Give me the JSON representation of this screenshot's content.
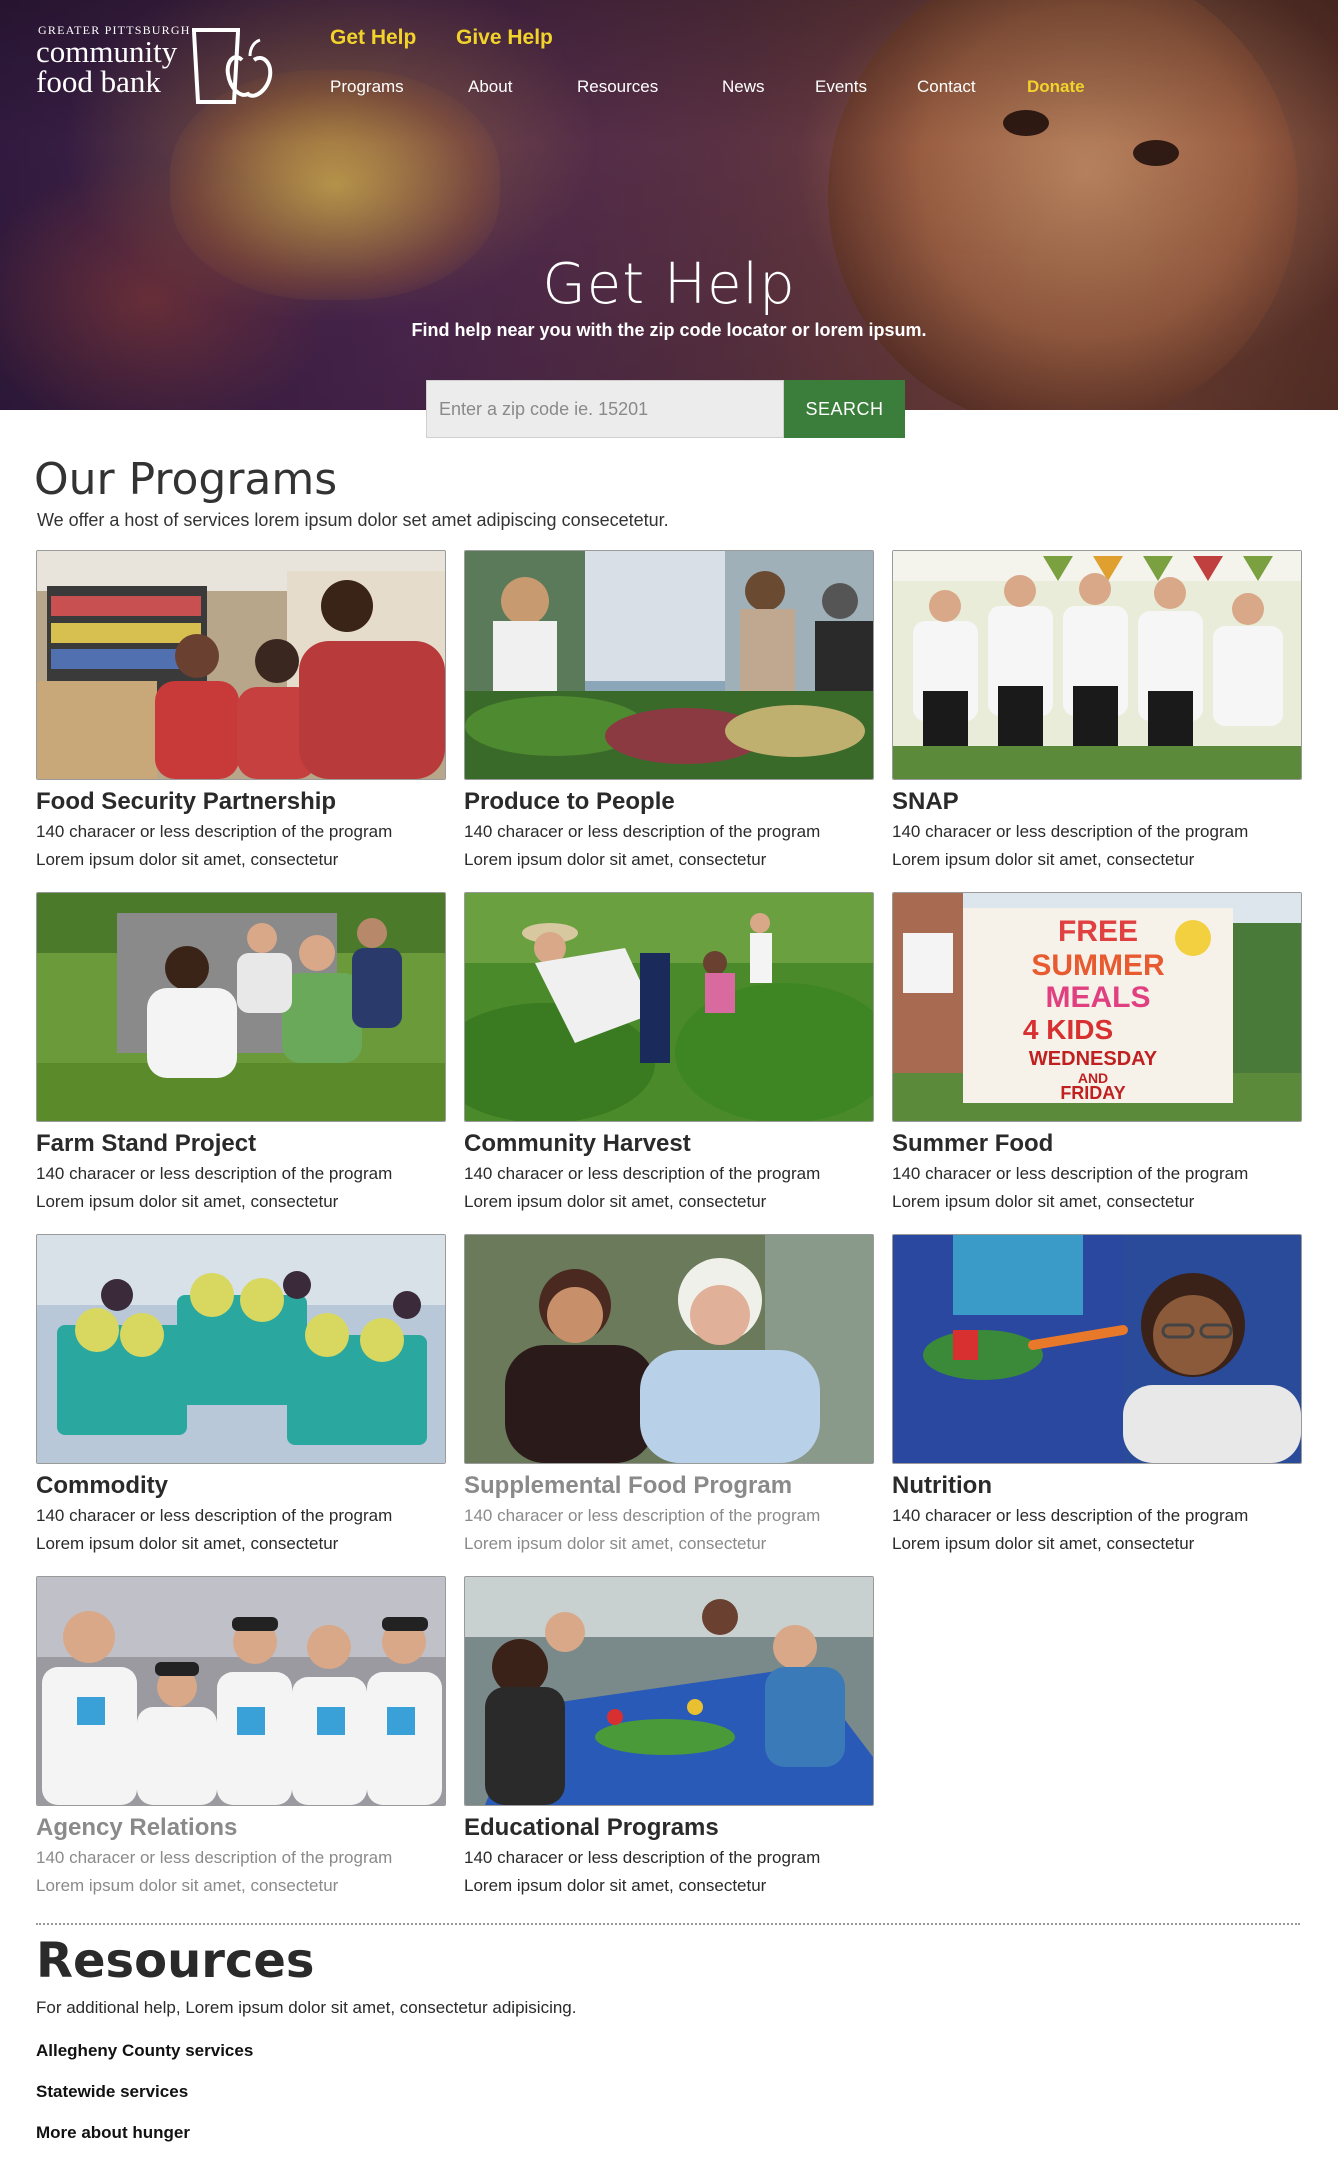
{
  "logo": {
    "small_text": "GREATER PITTSBURGH",
    "line1": "community",
    "line2": "food bank",
    "icon": "cup-apple-icon"
  },
  "nav": {
    "top": [
      "Get Help",
      "Give Help"
    ],
    "main": [
      "Programs",
      "About",
      "Resources",
      "News",
      "Events",
      "Contact",
      "Donate"
    ]
  },
  "hero": {
    "title": "Get Help",
    "subtitle": "Find help near you with the zip code locator or lorem ipsum.",
    "search_placeholder": "Enter a zip code ie. 15201",
    "search_button": "SEARCH"
  },
  "programs": {
    "title": "Our Programs",
    "subtitle": "We offer a host of services lorem ipsum dolor set amet adipiscing consecetetur.",
    "items": [
      {
        "title": "Food Security Partnership",
        "desc1": "140 characer or less description of the program",
        "desc2": "Lorem ipsum dolor sit amet, consectetur"
      },
      {
        "title": "Produce to People",
        "desc1": "140 characer or less description of the program",
        "desc2": "Lorem ipsum dolor sit amet, consectetur"
      },
      {
        "title": "SNAP",
        "desc1": "140 characer or less description of the program",
        "desc2": "Lorem ipsum dolor sit amet, consectetur"
      },
      {
        "title": "Farm Stand Project",
        "desc1": "140 characer or less description of the program",
        "desc2": "Lorem ipsum dolor sit amet, consectetur"
      },
      {
        "title": "Community Harvest",
        "desc1": "140 characer or less description of the program",
        "desc2": "Lorem ipsum dolor sit amet, consectetur"
      },
      {
        "title": "Summer Food",
        "desc1": "140 characer or less description of the program",
        "desc2": "Lorem ipsum dolor sit amet, consectetur"
      },
      {
        "title": "Commodity",
        "desc1": "140 characer or less description of the program",
        "desc2": "Lorem ipsum dolor sit amet, consectetur"
      },
      {
        "title": "Supplemental Food Program",
        "desc1": "140 characer or less description of the program",
        "desc2": "Lorem ipsum dolor sit amet, consectetur"
      },
      {
        "title": "Nutrition",
        "desc1": "140 characer or less description of the program",
        "desc2": "Lorem ipsum dolor sit amet, consectetur"
      },
      {
        "title": "Agency Relations",
        "desc1": "140 characer or less description of the program",
        "desc2": "Lorem ipsum dolor sit amet, consectetur"
      },
      {
        "title": "Educational Programs",
        "desc1": "140 characer or less description of the program",
        "desc2": "Lorem ipsum dolor sit amet, consectetur"
      }
    ],
    "photo_signs": {
      "summer_food": [
        "FREE",
        "SUMMER",
        "MEALS",
        "4 KIDS",
        "WEDNESDAY",
        "AND",
        "FRIDAY"
      ]
    }
  },
  "resources": {
    "title": "Resources",
    "subtitle": "For additional help, Lorem ipsum dolor sit amet, consectetur adipisicing.",
    "links": [
      "Allegheny County services",
      "Statewide services",
      "More about hunger"
    ]
  },
  "colors": {
    "nav_highlight": "#f2d32b",
    "search_button": "#3b7d3b",
    "muted_text": "#8a8a8a"
  }
}
